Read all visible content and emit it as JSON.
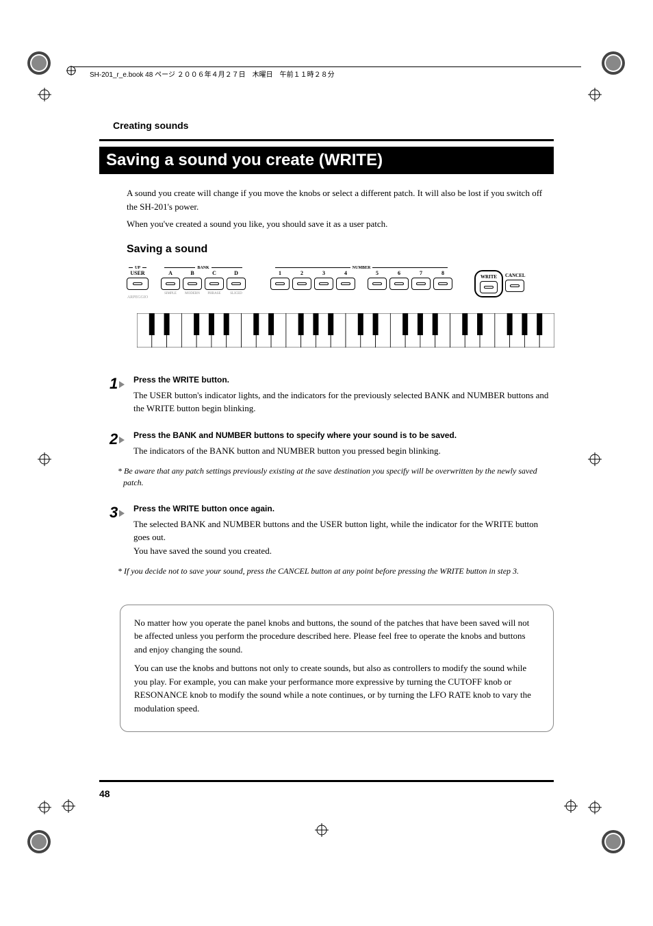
{
  "header": {
    "text": "SH-201_r_e.book  48 ページ  ２００６年４月２７日　木曜日　午前１１時２８分"
  },
  "breadcrumb": "Creating sounds",
  "title": "Saving a sound you create (WRITE)",
  "intro": {
    "p1": "A sound you create will change if you move the knobs or select a different patch. It will also be lost if you switch off the SH-201's power.",
    "p2": "When you've created a sound you like, you should save it as a user patch."
  },
  "section_heading": "Saving a sound",
  "panel": {
    "user": {
      "group": "UP",
      "label": "USER",
      "arpeggio": "ARPEGGIO"
    },
    "bank": {
      "group": "BANK",
      "buttons": [
        "A",
        "B",
        "C",
        "D"
      ],
      "sublabels": [
        "SIMPLE",
        "MODERN",
        "PHRASE",
        "SLICED"
      ]
    },
    "number": {
      "group": "NUMBER",
      "buttons": [
        "1",
        "2",
        "3",
        "4",
        "5",
        "6",
        "7",
        "8"
      ]
    },
    "write": "WRITE",
    "cancel": "CANCEL"
  },
  "steps": {
    "s1": {
      "num": "1",
      "title": "Press the WRITE button.",
      "text": "The USER button's indicator lights, and the indicators for the previously selected BANK and NUMBER buttons and the WRITE button begin blinking."
    },
    "s2": {
      "num": "2",
      "title": "Press the BANK and NUMBER buttons to specify where your sound is to be saved.",
      "text": "The indicators of the BANK button and NUMBER button you pressed begin blinking.",
      "note": "* Be aware that any patch settings previously existing at the save destination you specify will be overwritten by the newly saved patch."
    },
    "s3": {
      "num": "3",
      "title": "Press the WRITE button once again.",
      "text1": "The selected BANK and NUMBER buttons and the USER button light, while the indicator for the WRITE button goes out.",
      "text2": "You have saved the sound you created.",
      "note": "* If you decide not to save your sound, press the CANCEL button at any point before pressing the WRITE button in step 3."
    }
  },
  "info_box": {
    "p1": "No matter how you operate the panel knobs and buttons, the sound of the patches that have been saved will not be affected unless you perform the procedure described here. Please feel free to operate the knobs and buttons and enjoy changing the sound.",
    "p2": "You can use the knobs and buttons not only to create sounds, but also as controllers to modify the sound while you play. For example, you can make your performance more expressive by turning the CUTOFF knob or RESONANCE knob to modify the sound while a note continues, or by turning the LFO RATE knob to vary the modulation speed."
  },
  "page_number": "48"
}
